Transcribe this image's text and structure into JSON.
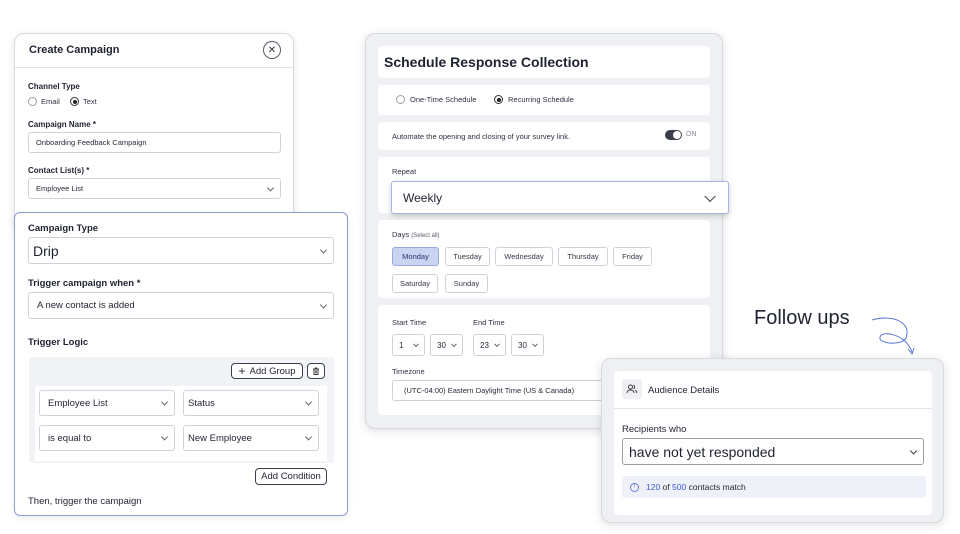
{
  "create_campaign": {
    "title": "Create Campaign",
    "channel_type_label": "Channel Type",
    "channel_options": [
      "Email",
      "Text"
    ],
    "campaign_name_label": "Campaign Name *",
    "campaign_name_value": "Onboarding Feedback Campaign",
    "contact_list_label": "Contact List(s) *",
    "contact_list_value": "Employee List"
  },
  "campaign_type": {
    "label": "Campaign Type",
    "value": "Drip",
    "trigger_label": "Trigger campaign when *",
    "trigger_value": "A new contact is added",
    "logic_label": "Trigger Logic",
    "add_group": "Add Group",
    "row1_left": "Employee List",
    "row1_right": "Status",
    "row2_left": "is equal to",
    "row2_right": "New Employee",
    "add_condition": "Add Condition",
    "footer": "Then, trigger the campaign"
  },
  "schedule": {
    "title": "Schedule Response Collection",
    "one_time": "One-Time Schedule",
    "recurring": "Recurring Schedule",
    "automate_text": "Automate the opening and closing of your survey link.",
    "toggle_label": "ON",
    "repeat_label": "Repeat",
    "repeat_value": "Weekly",
    "days_label": "Days",
    "select_all": "(Select all)",
    "days": [
      "Monday",
      "Tuesday",
      "Wednesday",
      "Thursday",
      "Friday",
      "Saturday",
      "Sunday"
    ],
    "start_time_label": "Start Time",
    "end_time_label": "End Time",
    "start_hour": "1",
    "start_min": "30",
    "end_hour": "23",
    "end_min": "30",
    "timezone_label": "Timezone",
    "timezone_value": "(UTC-04:00) Eastern Daylight Time (US & Canada)"
  },
  "follow_ups": "Follow ups",
  "audience": {
    "title": "Audience Details",
    "recipients_label": "Recipients who",
    "recipients_value": "have not yet responded",
    "match_count": "120",
    "match_of": "of",
    "match_total": "500",
    "match_suffix": "contacts match"
  },
  "colors": {
    "accent": "#8f9dd6",
    "link_blue": "#3b5bd6",
    "active_day": "#c9d3f2"
  }
}
